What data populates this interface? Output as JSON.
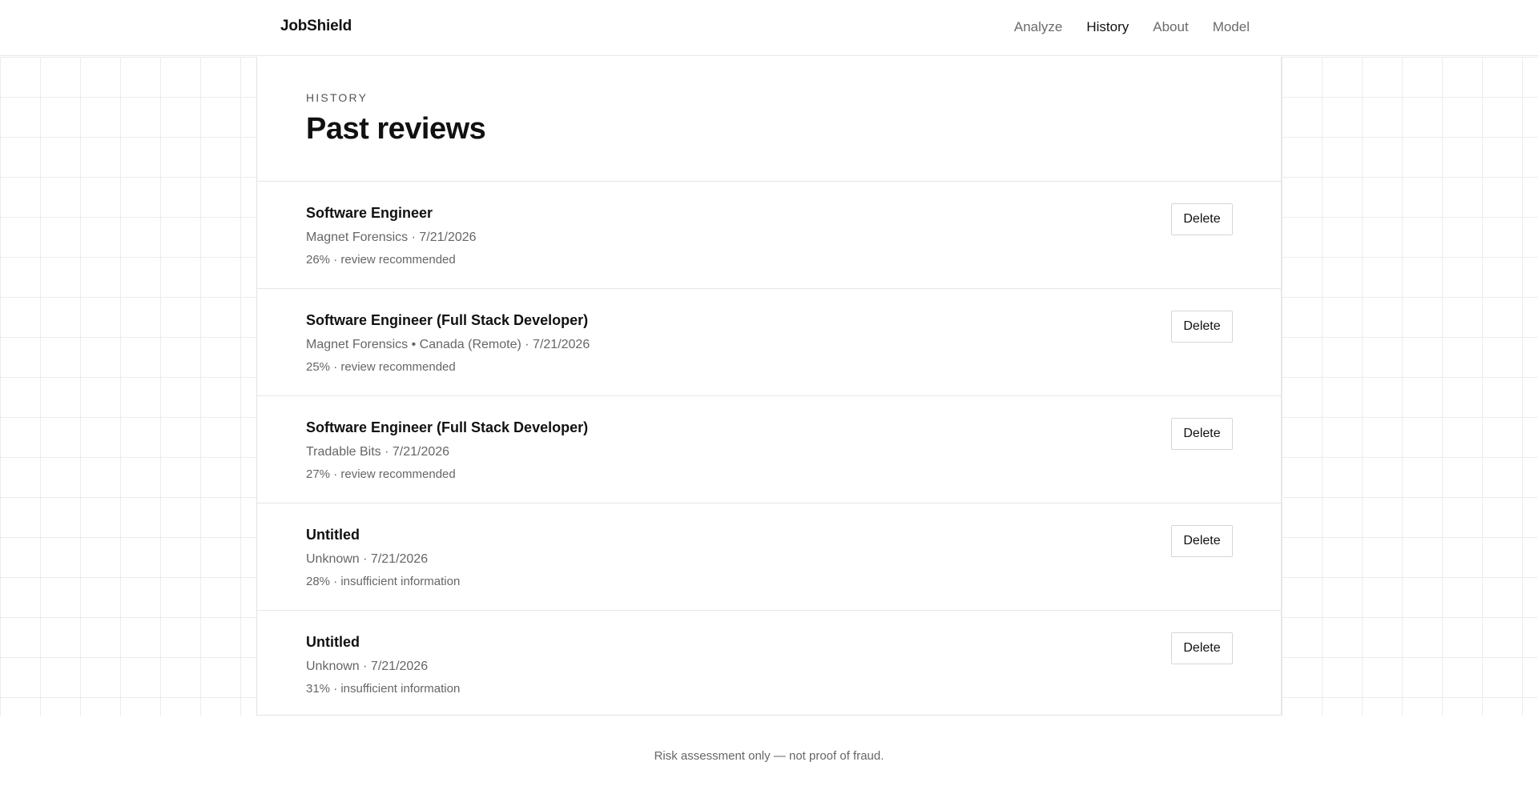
{
  "header": {
    "brand": "JobShield",
    "nav": [
      {
        "label": "Analyze",
        "active": false
      },
      {
        "label": "History",
        "active": true
      },
      {
        "label": "About",
        "active": false
      },
      {
        "label": "Model",
        "active": false
      }
    ]
  },
  "page": {
    "eyebrow": "HISTORY",
    "title": "Past reviews"
  },
  "reviews": [
    {
      "title": "Software Engineer",
      "meta": "Magnet Forensics · 7/21/2026",
      "score": "26% · review recommended",
      "delete_label": "Delete"
    },
    {
      "title": "Software Engineer (Full Stack Developer)",
      "meta": "Magnet Forensics • Canada (Remote) · 7/21/2026",
      "score": "25% · review recommended",
      "delete_label": "Delete"
    },
    {
      "title": "Software Engineer (Full Stack Developer)",
      "meta": "Tradable Bits · 7/21/2026",
      "score": "27% · review recommended",
      "delete_label": "Delete"
    },
    {
      "title": "Untitled",
      "meta": "Unknown · 7/21/2026",
      "score": "28% · insufficient information",
      "delete_label": "Delete"
    },
    {
      "title": "Untitled",
      "meta": "Unknown · 7/21/2026",
      "score": "31% · insufficient information",
      "delete_label": "Delete"
    }
  ],
  "footer": {
    "text": "Risk assessment only — not proof of fraud."
  },
  "colors": {
    "text": "#111111",
    "muted": "#666666",
    "border": "#e6e6e6",
    "grid": "#ececec"
  }
}
